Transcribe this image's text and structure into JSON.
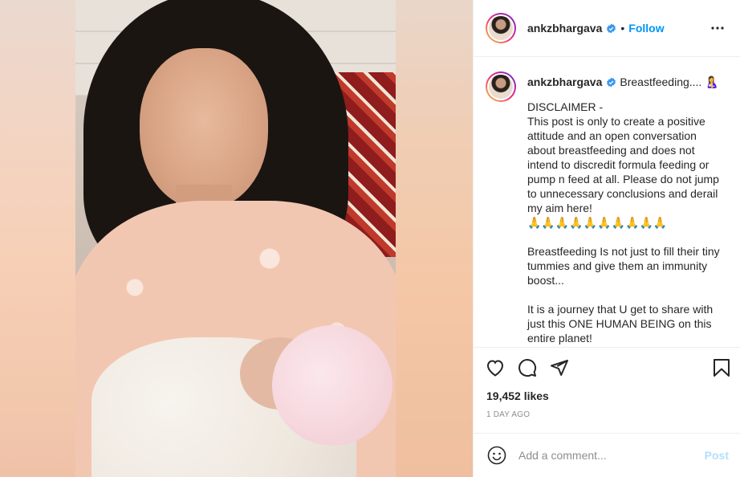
{
  "header": {
    "username": "ankzbhargava",
    "dot": "•",
    "follow_label": "Follow"
  },
  "caption": {
    "username": "ankzbhargava",
    "lead": "Breastfeeding.... 🤱",
    "text": "DISCLAIMER -\nThis post is only to create a positive attitude and an open conversation about breastfeeding and does not intend to discredit formula feeding or pump n feed at all. Please do not jump to unnecessary conclusions and derail my aim here!\n🙏🙏🙏🙏🙏🙏🙏🙏🙏🙏\n\nBreastfeeding Is not just to fill their tiny tummies and give them an immunity boost...\n\nIt is a journey that U get to share with just this ONE HUMAN BEING on this entire planet!"
  },
  "stats": {
    "likes": "19,452 likes",
    "time": "1 DAY AGO"
  },
  "comment": {
    "placeholder": "Add a comment...",
    "post_label": "Post"
  },
  "icons": {
    "verified": "verified-badge-icon",
    "more": "more-options-icon",
    "like": "heart-icon",
    "comment": "comment-icon",
    "share": "share-icon",
    "save": "bookmark-icon",
    "emoji": "emoji-icon"
  },
  "colors": {
    "accent": "#0095f6",
    "post_disabled": "#b2dffc",
    "muted": "#8e8e8e",
    "text": "#262626",
    "border": "#efefef"
  }
}
